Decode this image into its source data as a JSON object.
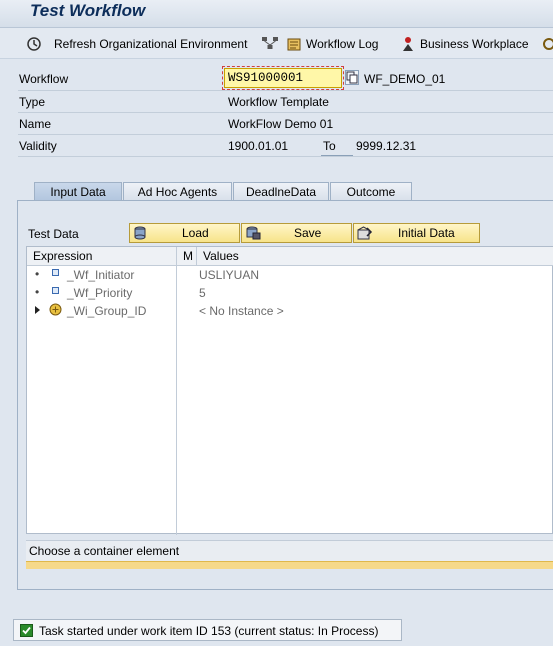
{
  "title": "Test Workflow",
  "toolbar": {
    "refresh_label": "Refresh Organizational Environment",
    "workflow_log_label": "Workflow Log",
    "business_workplace_label": "Business Workplace"
  },
  "header": {
    "workflow_label": "Workflow",
    "workflow_value": "WS91000001",
    "workflow_name": "WF_DEMO_01",
    "type_label": "Type",
    "type_value": "Workflow Template",
    "name_label": "Name",
    "name_value": "WorkFlow Demo 01",
    "validity_label": "Validity",
    "validity_from": "1900.01.01",
    "to_label": "To",
    "validity_to": "9999.12.31"
  },
  "tabs": [
    {
      "label": "Input Data",
      "active": true
    },
    {
      "label": "Ad Hoc Agents",
      "active": false
    },
    {
      "label": "DeadlneData",
      "active": false
    },
    {
      "label": "Outcome",
      "active": false
    }
  ],
  "input_data": {
    "test_data_label": "Test Data",
    "load_label": "Load",
    "save_label": "Save",
    "initial_data_label": "Initial Data",
    "columns": {
      "expression": "Expression",
      "m": "M",
      "values": "Values"
    },
    "rows": [
      {
        "expression": "_Wf_Initiator",
        "value": "USLIYUAN"
      },
      {
        "expression": "_Wf_Priority",
        "value": "5"
      },
      {
        "expression": "_Wi_Group_ID",
        "value": "< No Instance >"
      }
    ],
    "detail_text": "Choose a container element"
  },
  "statusbar": {
    "message": "Task started under work item ID 153 (current status: In Process)",
    "status_color": "#2a8a2a"
  },
  "icons": [
    "refresh-icon",
    "org-icon",
    "workflow-log-icon",
    "business-workplace-icon",
    "more-icon",
    "copy-icon",
    "load-icon",
    "save-icon",
    "initial-data-icon",
    "element-icon",
    "structure-icon",
    "success-icon"
  ]
}
